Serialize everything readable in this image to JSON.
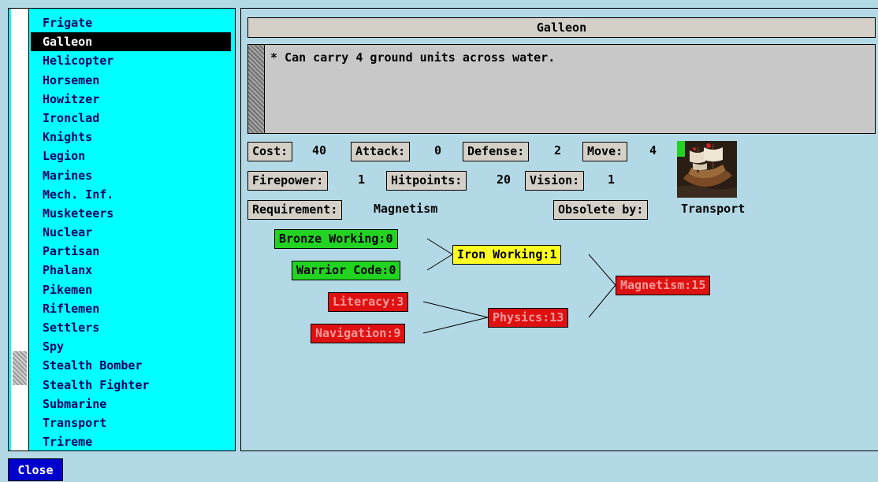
{
  "unit_list": [
    "Frigate",
    "Galleon",
    "Helicopter",
    "Horsemen",
    "Howitzer",
    "Ironclad",
    "Knights",
    "Legion",
    "Marines",
    "Mech. Inf.",
    "Musketeers",
    "Nuclear",
    "Partisan",
    "Phalanx",
    "Pikemen",
    "Riflemen",
    "Settlers",
    "Spy",
    "Stealth Bomber",
    "Stealth Fighter",
    "Submarine",
    "Transport",
    "Trireme"
  ],
  "selected_unit": "Galleon",
  "title": "Galleon",
  "help_text": "* Can carry 4 ground units across water.",
  "stats": {
    "cost_label": "Cost:",
    "cost": "40",
    "attack_label": "Attack:",
    "attack": "0",
    "defense_label": "Defense:",
    "defense": "2",
    "move_label": "Move:",
    "move": "4",
    "firepower_label": "Firepower:",
    "firepower": "1",
    "hitpoints_label": "Hitpoints:",
    "hitpoints": "20",
    "vision_label": "Vision:",
    "vision": "1",
    "requirement_label": "Requirement:",
    "requirement": "Magnetism",
    "obsolete_label": "Obsolete by:",
    "obsolete_by": "Transport"
  },
  "unit_image_icon": "galleon-ship-icon",
  "tech_tree": {
    "bronze_working": "Bronze Working:0",
    "warrior_code": "Warrior Code:0",
    "iron_working": "Iron Working:1",
    "literacy": "Literacy:3",
    "navigation": "Navigation:9",
    "physics": "Physics:13",
    "magnetism": "Magnetism:15"
  },
  "colors": {
    "known": "#22d322",
    "reachable": "#ffff22",
    "unknown": "#dd1111"
  },
  "close_label": "Close"
}
